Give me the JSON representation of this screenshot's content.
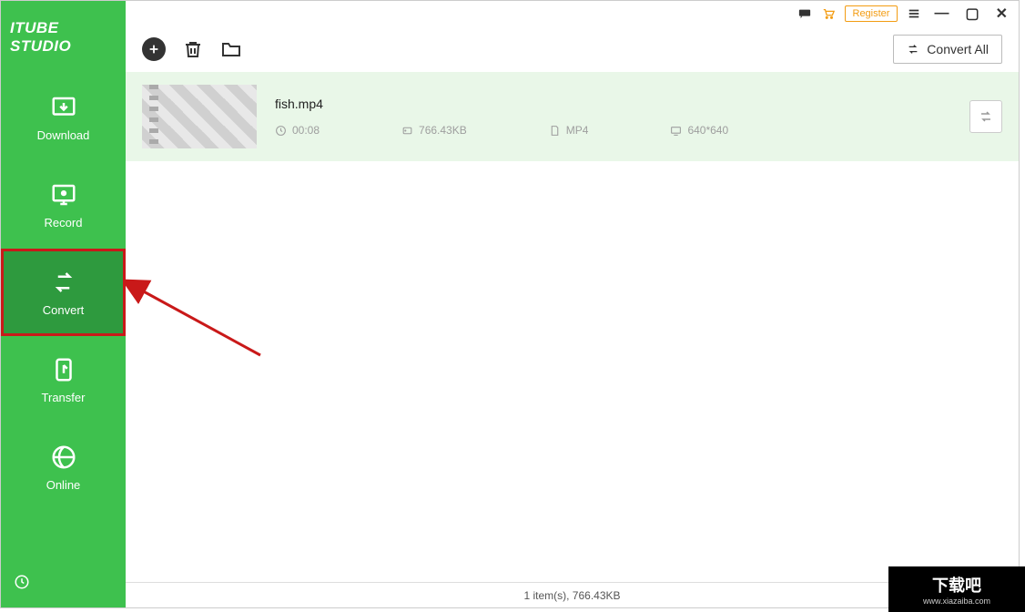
{
  "app": {
    "name": "ITUBE STUDIO"
  },
  "sidebar": {
    "items": [
      {
        "label": "Download"
      },
      {
        "label": "Record"
      },
      {
        "label": "Convert"
      },
      {
        "label": "Transfer"
      },
      {
        "label": "Online"
      }
    ]
  },
  "titlebar": {
    "register_label": "Register"
  },
  "toolbar": {
    "convert_all_label": "Convert All"
  },
  "files": [
    {
      "name": "fish.mp4",
      "duration": "00:08",
      "size": "766.43KB",
      "format": "MP4",
      "resolution": "640*640"
    }
  ],
  "statusbar": {
    "text": "1 item(s), 766.43KB"
  },
  "watermark": {
    "main": "下载吧",
    "sub": "www.xiazaiba.com"
  }
}
